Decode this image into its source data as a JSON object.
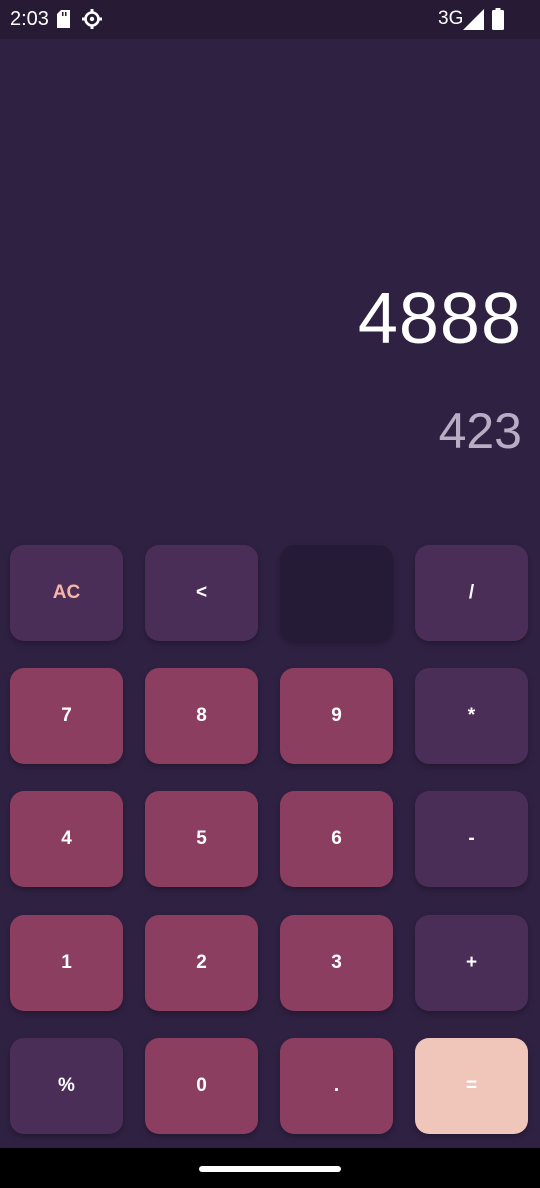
{
  "status_bar": {
    "time": "2:03",
    "network": "3G",
    "icons": [
      "sd-card-icon",
      "gear-icon",
      "signal-icon",
      "battery-icon"
    ]
  },
  "display": {
    "result": "4888",
    "expression": "423"
  },
  "keys": {
    "ac": "AC",
    "backspace": "<",
    "blank": "",
    "divide": "/",
    "seven": "7",
    "eight": "8",
    "nine": "9",
    "multiply": "*",
    "four": "4",
    "five": "5",
    "six": "6",
    "minus": "-",
    "one": "1",
    "two": "2",
    "three": "3",
    "plus": "+",
    "percent": "%",
    "zero": "0",
    "dot": ".",
    "equals": "="
  },
  "colors": {
    "background": "#2f2142",
    "status_bar": "#261a35",
    "operator_key": "#4b2e58",
    "number_key": "#8c3e61",
    "blank_key": "#261b37",
    "equals_key": "#f0c5ba",
    "ac_text": "#f6b5a9",
    "result_text": "#ffffff",
    "expression_text": "#b7adc5"
  }
}
